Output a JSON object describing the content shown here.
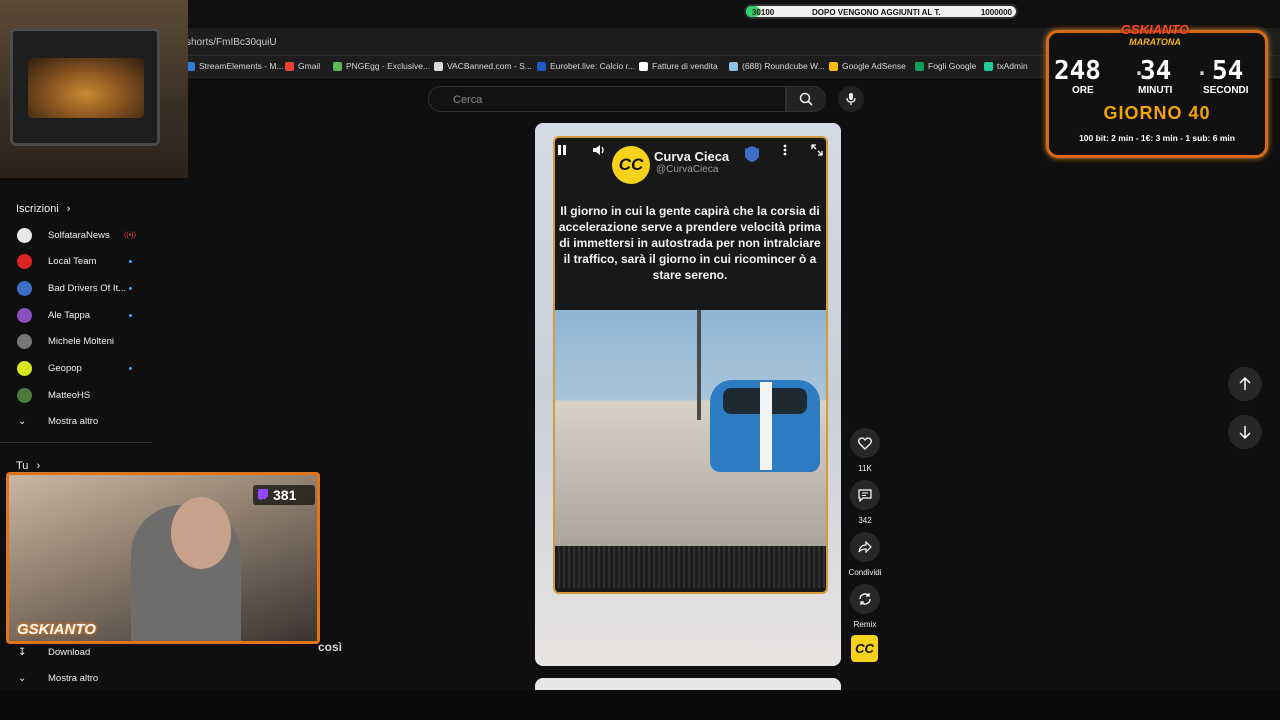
{
  "browser": {
    "url": "shorts/FmIBc30quiU",
    "bookmarks": [
      {
        "label": "StreamElements - M...",
        "color": "#2f7bd6"
      },
      {
        "label": "Gmail",
        "color": "#ea4335"
      },
      {
        "label": "PNGEgg - Exclusive...",
        "color": "#5db85a"
      },
      {
        "label": "VACBanned.com - S...",
        "color": "#dddddd"
      },
      {
        "label": "Eurobet.live: Calcio r...",
        "color": "#1b59c4"
      },
      {
        "label": "Fatture di vendita",
        "color": "#ffffff"
      },
      {
        "label": "(688) Roundcube W...",
        "color": "#8fc1e8"
      },
      {
        "label": "Google AdSense",
        "color": "#fbbc05"
      },
      {
        "label": "Fogli Google",
        "color": "#0f9d58"
      },
      {
        "label": "txAdmin",
        "color": "#20c997"
      }
    ]
  },
  "goal": {
    "start": "30100",
    "text": "DOPO VENGONO AGGIUNTI AL T.",
    "end": "1000000",
    "progress": 0.03
  },
  "search": {
    "placeholder": "Cerca"
  },
  "sidebar": {
    "subscriptions_header": "Iscrizioni",
    "subscriptions": [
      {
        "label": "SolfataraNews",
        "avatar_color": "#e8e8e8",
        "live": "((•))"
      },
      {
        "label": "Local Team",
        "avatar_color": "#e02424",
        "new": true
      },
      {
        "label": "Bad Drivers Of It...",
        "avatar_color": "#3b6fc4",
        "new": true
      },
      {
        "label": "Ale Tappa",
        "avatar_color": "#8a4fbf",
        "new": true
      },
      {
        "label": "Michele Molteni",
        "avatar_color": "#777777",
        "new": false
      },
      {
        "label": "Geopop",
        "avatar_color": "#d8e81e",
        "new": true
      },
      {
        "label": "MatteoHS",
        "avatar_color": "#4d7a3a",
        "new": false
      }
    ],
    "show_more": "Mostra altro",
    "you_header": "Tu",
    "download": "Download",
    "show_more_2": "Mostra altro"
  },
  "webcam": {
    "viewers": "381",
    "brand": "GSKIANTO"
  },
  "overlay_title_fragment": "così",
  "timer": {
    "brand": "GSKIANTO",
    "subtitle": "MARATONA",
    "hours": "248",
    "minutes": "34",
    "seconds": "54",
    "hours_label": "ORE",
    "minutes_label": "MINUTI",
    "seconds_label": "SECONDI",
    "day": "GIORNO 40",
    "rates": "100 bit: 2 min - 1€: 3 min - 1 sub: 6 min"
  },
  "short": {
    "channel_name": "Curva Cieca",
    "channel_handle": "@CurvaCieca",
    "logo_text": "CC",
    "caption": "Il giorno in cui la gente capirà che la corsia di accelerazione serve a prendere velocità prima di immettersi in autostrada per non intralciare il traffico, sarà il giorno in cui ricomincer ò a stare sereno."
  },
  "actions": {
    "likes": "11K",
    "comments": "342",
    "share": "Condividi",
    "remix": "Remix"
  }
}
